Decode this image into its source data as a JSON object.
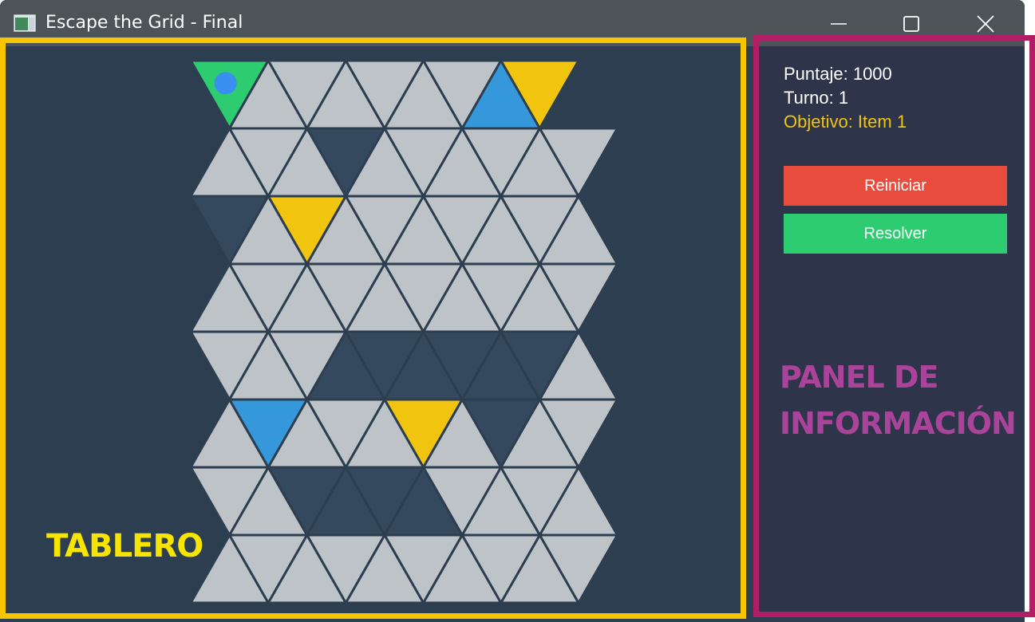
{
  "window": {
    "title": "Escape the Grid - Final",
    "controls": [
      "minimize-icon",
      "maximize-icon",
      "close-icon"
    ]
  },
  "board": {
    "label": "TABLERO",
    "rows": 8,
    "cols": 10,
    "colors": {
      "floor": "#bdc3c7",
      "wall": "#34495e",
      "player_cell": "#2ecc71",
      "item": "#f1c40f",
      "portal": "#3498db",
      "player": "#3a8ef0"
    },
    "cells": [
      [
        "start",
        "floor",
        "floor",
        "floor",
        "floor",
        "floor",
        "floor",
        "portal",
        "item",
        "empty"
      ],
      [
        "floor",
        "floor",
        "floor",
        "wall",
        "floor",
        "floor",
        "floor",
        "floor",
        "floor",
        "floor"
      ],
      [
        "wall",
        "floor",
        "item",
        "floor",
        "floor",
        "floor",
        "floor",
        "floor",
        "floor",
        "floor"
      ],
      [
        "floor",
        "floor",
        "floor",
        "floor",
        "floor",
        "floor",
        "floor",
        "floor",
        "floor",
        "floor"
      ],
      [
        "floor",
        "floor",
        "floor",
        "wall",
        "wall",
        "wall",
        "wall",
        "wall",
        "wall",
        "floor"
      ],
      [
        "floor",
        "portal",
        "floor",
        "floor",
        "floor",
        "item",
        "floor",
        "wall",
        "floor",
        "floor"
      ],
      [
        "floor",
        "floor",
        "wall",
        "wall",
        "wall",
        "wall",
        "floor",
        "floor",
        "floor",
        "floor"
      ],
      [
        "floor",
        "floor",
        "floor",
        "floor",
        "floor",
        "floor",
        "floor",
        "floor",
        "floor",
        "floor"
      ]
    ],
    "player": {
      "row": 0,
      "col": 0
    }
  },
  "info_panel": {
    "label": "PANEL DE INFORMACIÓN",
    "score": "Puntaje: 1000",
    "turn": "Turno: 1",
    "goal": "Objetivo: Item 1",
    "reset_button": "Reiniciar",
    "solve_button": "Resolver",
    "colors": {
      "reset": "#e74c3c",
      "solve": "#2ecc71",
      "goal_text": "#f1c40f"
    }
  }
}
